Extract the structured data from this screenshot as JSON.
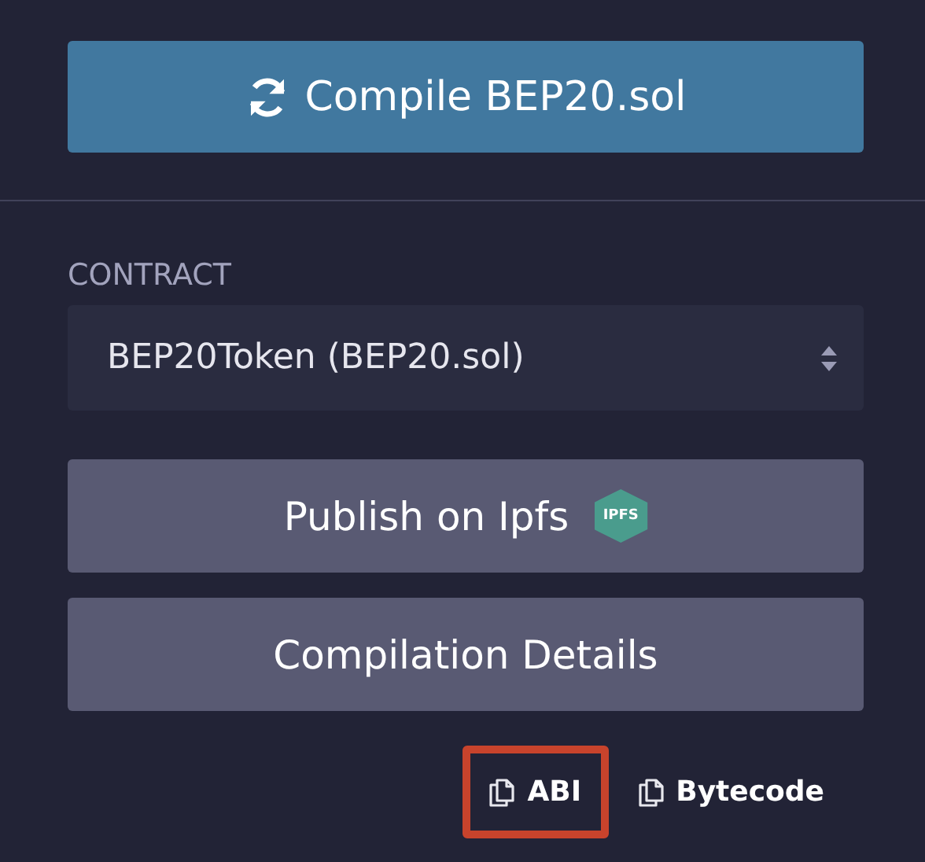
{
  "compile_button": {
    "label": "Compile BEP20.sol"
  },
  "contract": {
    "label": "CONTRACT",
    "value": "BEP20Token (BEP20.sol)"
  },
  "buttons": [
    {
      "kind": "ipfs",
      "label": "Publish on Ipfs",
      "badge": "IPFS"
    },
    {
      "kind": "plain",
      "label": "Compilation Details"
    }
  ],
  "copy_links": [
    {
      "label": "ABI",
      "highlighted": true
    },
    {
      "label": "Bytecode",
      "highlighted": false
    }
  ]
}
